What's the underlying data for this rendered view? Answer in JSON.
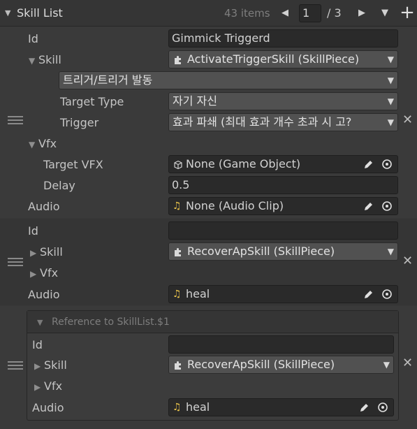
{
  "header": {
    "title": "Skill List",
    "items_count": "43 items",
    "page_current": "1",
    "page_total": "/ 3"
  },
  "elements": [
    {
      "id_label": "Id",
      "id_value": "Gimmick Triggerd",
      "skill_label": "Skill",
      "skill_value": "ActivateTriggerSkill (SkillPiece)",
      "sub_dropdown": "트리거/트리거 발동",
      "target_type_label": "Target Type",
      "target_type_value": "자기 자신",
      "trigger_label": "Trigger",
      "trigger_value": "효과 파쇄 (최대 효과 개수 초과 시 고?",
      "vfx_label": "Vfx",
      "target_vfx_label": "Target VFX",
      "target_vfx_value": "None (Game Object)",
      "delay_label": "Delay",
      "delay_value": "0.5",
      "audio_label": "Audio",
      "audio_value": "None (Audio Clip)"
    },
    {
      "id_label": "Id",
      "id_value": "",
      "skill_label": "Skill",
      "skill_value": "RecoverApSkill (SkillPiece)",
      "vfx_label": "Vfx",
      "audio_label": "Audio",
      "audio_value": "heal"
    },
    {
      "reference_label": "Reference to SkillList.$1",
      "id_label": "Id",
      "id_value": "",
      "skill_label": "Skill",
      "skill_value": "RecoverApSkill (SkillPiece)",
      "vfx_label": "Vfx",
      "audio_label": "Audio",
      "audio_value": "heal"
    }
  ],
  "icons": {
    "component": "puzzle-piece-icon",
    "gameobject": "cube-icon",
    "audio": "music-note-icon",
    "edit": "pencil-icon",
    "select": "target-circle-icon"
  }
}
